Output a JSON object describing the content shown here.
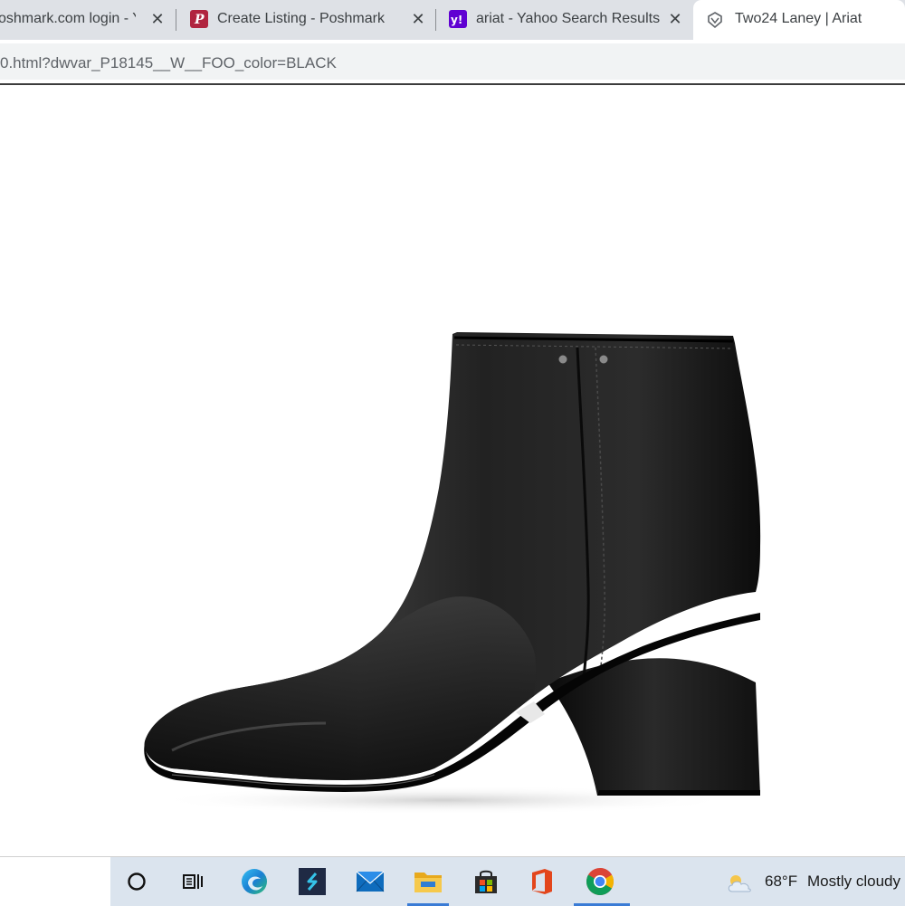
{
  "browser": {
    "tabs": [
      {
        "title": "oshmark.com login - Y",
        "close_label": "✕",
        "favicon": "yahoo-favicon-hidden"
      },
      {
        "title": "Create Listing - Poshmark",
        "close_label": "✕",
        "favicon": "poshmark-favicon"
      },
      {
        "title": "ariat - Yahoo Search Results",
        "close_label": "✕",
        "favicon": "yahoo-favicon"
      },
      {
        "title": "Two24 Laney | Ariat",
        "favicon": "ariat-favicon",
        "active": true
      }
    ],
    "url": "0.html?dwvar_P18145__W__FOO_color=BLACK"
  },
  "page": {
    "product_image": "black-leather-ankle-boot"
  },
  "taskbar": {
    "icons": [
      "cortana-circle-icon",
      "task-view-icon",
      "edge-icon",
      "app-s-icon",
      "mail-icon",
      "file-explorer-icon",
      "store-icon",
      "office-icon",
      "chrome-icon"
    ],
    "weather": {
      "icon": "cloudy-icon",
      "temperature": "68°F",
      "condition": "Mostly cloudy"
    }
  },
  "colors": {
    "tabstrip": "#dee1e6",
    "active_tab": "#ffffff",
    "poshmark": "#b0243f",
    "yahoo": "#6001d2",
    "taskbar_band": "#dbe4ee",
    "taskbar_accent": "#3a7bd5"
  }
}
